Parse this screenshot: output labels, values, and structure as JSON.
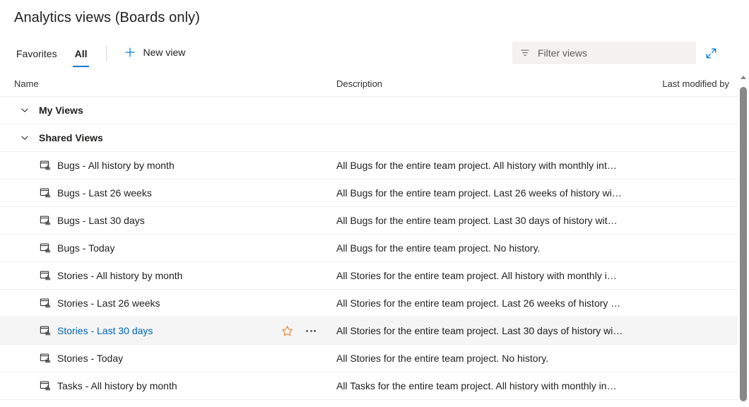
{
  "page": {
    "title": "Analytics views (Boards only)"
  },
  "toolbar": {
    "tabs": [
      {
        "label": "Favorites",
        "selected": false
      },
      {
        "label": "All",
        "selected": true
      }
    ],
    "new_view_label": "New view",
    "new_view_icon": "plus-icon",
    "filter": {
      "placeholder": "Filter views",
      "value": "",
      "icon": "filter-funnel-icon"
    },
    "expand_icon": "expand-diagonal-icon"
  },
  "list": {
    "columns": {
      "name": "Name",
      "description": "Description",
      "last_modified_by": "Last modified by"
    },
    "groups": [
      {
        "label": "My Views",
        "expanded": true,
        "chevron_icon": "chevron-down-icon",
        "items": []
      },
      {
        "label": "Shared Views",
        "expanded": true,
        "chevron_icon": "chevron-down-icon",
        "items": [
          {
            "icon": "analytics-view-icon",
            "name": "Bugs - All history by month",
            "description": "All Bugs for the entire team project. All history with monthly int…",
            "last_modified_by": "",
            "hovered": false
          },
          {
            "icon": "analytics-view-icon",
            "name": "Bugs - Last 26 weeks",
            "description": "All Bugs for the entire team project. Last 26 weeks of history wi…",
            "last_modified_by": "",
            "hovered": false
          },
          {
            "icon": "analytics-view-icon",
            "name": "Bugs - Last 30 days",
            "description": "All Bugs for the entire team project. Last 30 days of history wit…",
            "last_modified_by": "",
            "hovered": false
          },
          {
            "icon": "analytics-view-icon",
            "name": "Bugs - Today",
            "description": "All Bugs for the entire team project. No history.",
            "last_modified_by": "",
            "hovered": false
          },
          {
            "icon": "analytics-view-icon",
            "name": "Stories - All history by month",
            "description": "All Stories for the entire team project. All history with monthly i…",
            "last_modified_by": "",
            "hovered": false
          },
          {
            "icon": "analytics-view-icon",
            "name": "Stories - Last 26 weeks",
            "description": "All Stories for the entire team project. Last 26 weeks of history …",
            "last_modified_by": "",
            "hovered": false
          },
          {
            "icon": "analytics-view-icon",
            "name": "Stories - Last 30 days",
            "description": "All Stories for the entire team project. Last 30 days of history wi…",
            "last_modified_by": "",
            "hovered": true,
            "actions": {
              "favorite_icon": "star-outline-icon",
              "more_icon": "more-ellipsis-icon"
            }
          },
          {
            "icon": "analytics-view-icon",
            "name": "Stories - Today",
            "description": "All Stories for the entire team project. No history.",
            "last_modified_by": "",
            "hovered": false
          },
          {
            "icon": "analytics-view-icon",
            "name": "Tasks - All history by month",
            "description": "All Tasks for the entire team project. All history with monthly in…",
            "last_modified_by": "",
            "hovered": false
          }
        ]
      }
    ]
  },
  "scrollbar": {
    "up_arrow_icon": "scroll-up-arrow-icon"
  },
  "colors": {
    "accent": "#0078d4",
    "link": "#0066b4",
    "favorite_star": "#e8873c",
    "hover_row": "#f5f5f5",
    "filter_background": "#f3f2f1"
  }
}
